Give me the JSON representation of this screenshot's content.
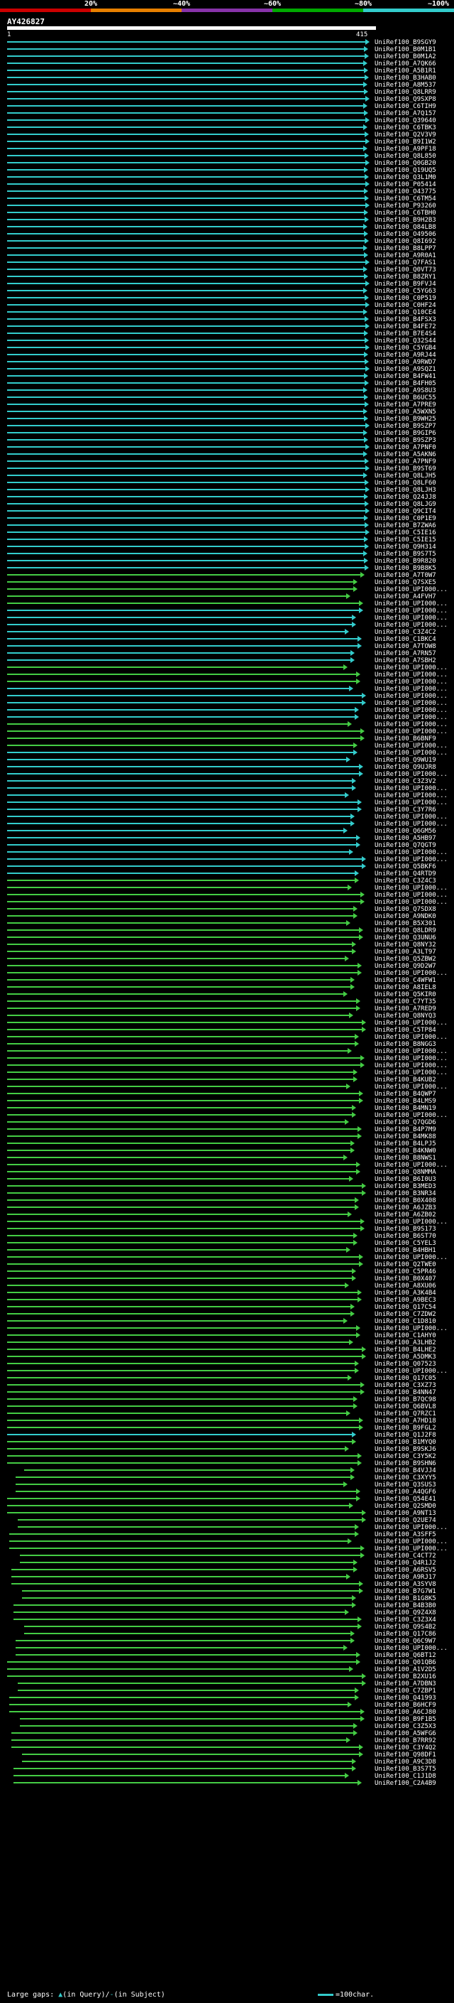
{
  "scale": {
    "labels": [
      "20%",
      "~40%",
      "~60%",
      "~80%",
      "~100%"
    ],
    "colors": [
      "#cc0000",
      "#e88000",
      "#8833aa",
      "#00aa00",
      "#33cccc"
    ]
  },
  "query": {
    "name": "AY426827",
    "start": "1",
    "end": "415"
  },
  "colors": {
    "cyan": "#33cccc",
    "green": "#44cc44",
    "gap": "#222222"
  },
  "hits": [
    "UniRef100_B9SGY9",
    "UniRef100_B0M1B1",
    "UniRef100_B0M1A2",
    "UniRef100_A7QK66",
    "UniRef100_A5B1R1",
    "UniRef100_B3HAB0",
    "UniRef100_A8M537",
    "UniRef100_Q8LRR9",
    "UniRef100_Q9SXP8",
    "UniRef100_C6TIH9",
    "UniRef100_A7Q157",
    "UniRef100_Q39640",
    "UniRef100_C6TBK3",
    "UniRef100_Q2V3V9",
    "UniRef100_B9I1W2",
    "UniRef100_A9PF18",
    "UniRef100_Q8L850",
    "UniRef100_Q0GB20",
    "UniRef100_Q19UQ5",
    "UniRef100_Q3L1M0",
    "UniRef100_P05414",
    "UniRef100_O43775",
    "UniRef100_C6TM54",
    "UniRef100_P93260",
    "UniRef100_C6TBH0",
    "UniRef100_B9H2B3",
    "UniRef100_Q84LB8",
    "UniRef100_O49506",
    "UniRef100_Q8I692",
    "UniRef100_B8LPP7",
    "UniRef100_A9R0A1",
    "UniRef100_Q7FAS1",
    "UniRef100_Q0VT73",
    "UniRef100_B8ZRY1",
    "UniRef100_B9FVJ4",
    "UniRef100_C5YG63",
    "UniRef100_C0P519",
    "UniRef100_C0HF24",
    "UniRef100_Q10CE4",
    "UniRef100_B4FSX3",
    "UniRef100_B4FE72",
    "UniRef100_B7E4S4",
    "UniRef100_Q32S44",
    "UniRef100_C5YGB4",
    "UniRef100_A9RJ44",
    "UniRef100_A9RWD7",
    "UniRef100_A9SQZ1",
    "UniRef100_B4FW41",
    "UniRef100_B4FH05",
    "UniRef100_A9S8U3",
    "UniRef100_B6UC55",
    "UniRef100_A7PRE9",
    "UniRef100_A5WXN5",
    "UniRef100_B9WH25",
    "UniRef100_B9SZP7",
    "UniRef100_B9GIP6",
    "UniRef100_B9SZP3",
    "UniRef100_A7PNF0",
    "UniRef100_A5AKN6",
    "UniRef100_A7PNF9",
    "UniRef100_B9ST69",
    "UniRef100_Q8LJH5",
    "UniRef100_Q8LF60",
    "UniRef100_Q8LJH3",
    "UniRef100_Q24JJ8",
    "UniRef100_Q8LJG9",
    "UniRef100_Q9CIT4",
    "UniRef100_C0P1E9",
    "UniRef100_B7ZWA6",
    "UniRef100_C5IE16",
    "UniRef100_C5IE15",
    "UniRef100_Q9H314",
    "UniRef100_B9S7T5",
    "UniRef100_B9R820",
    "UniRef100_B9B8K5",
    "UniRef100_A7T0W7",
    "UniRef100_Q7SXE5",
    "UniRef100_UPI000...",
    "UniRef100_A4FVH7",
    "UniRef100_UPI000...",
    "UniRef100_UPI000...",
    "UniRef100_UPI000...",
    "UniRef100_UPI000...",
    "UniRef100_C3Z4C2",
    "UniRef100_C1BKC4",
    "UniRef100_A7TOW8",
    "UniRef100_A7RN57",
    "UniRef100_A7SBH2",
    "UniRef100_UPI000...",
    "UniRef100_UPI000...",
    "UniRef100_UPI000...",
    "UniRef100_UPI000...",
    "UniRef100_UPI000...",
    "UniRef100_UPI000...",
    "UniRef100_UPI000...",
    "UniRef100_UPI000...",
    "UniRef100_UPI000...",
    "UniRef100_UPI000...",
    "UniRef100_B6BNF9",
    "UniRef100_UPI000...",
    "UniRef100_UPI000...",
    "UniRef100_Q9WU19",
    "UniRef100_Q9UJR8",
    "UniRef100_UPI000...",
    "UniRef100_C3Z3V2",
    "UniRef100_UPI000...",
    "UniRef100_UPI000...",
    "UniRef100_UPI000...",
    "UniRef100_C3Y7R6",
    "UniRef100_UPI000...",
    "UniRef100_UPI000...",
    "UniRef100_Q6GM56",
    "UniRef100_A5HB97",
    "UniRef100_Q7QGT9",
    "UniRef100_UPI000...",
    "UniRef100_UPI000...",
    "UniRef100_Q5BKF6",
    "UniRef100_Q4RTD9",
    "UniRef100_C3Z4C3",
    "UniRef100_UPI000...",
    "UniRef100_UPI000...",
    "UniRef100_UPI000...",
    "UniRef100_Q7SDX8",
    "UniRef100_A9NDK0",
    "UniRef100_B5X301",
    "UniRef100_Q8LDR9",
    "UniRef100_Q3UNU6",
    "UniRef100_Q8NY32",
    "UniRef100_A3LT97",
    "UniRef100_Q5ZBW2",
    "UniRef100_Q9D2W7",
    "UniRef100_UPI000...",
    "UniRef100_C4WFW1",
    "UniRef100_A8IEL8",
    "UniRef100_Q5KIR0",
    "UniRef100_C7YT35",
    "UniRef100_A7RED9",
    "UniRef100_Q8NYQ3",
    "UniRef100_UPI000...",
    "UniRef100_C5TP84",
    "UniRef100_UPI000...",
    "UniRef100_B8NGG3",
    "UniRef100_UPI000...",
    "UniRef100_UPI000...",
    "UniRef100_UPI000...",
    "UniRef100_UPI000...",
    "UniRef100_B4KUB2",
    "UniRef100_UPI000...",
    "UniRef100_B4QWP7",
    "UniRef100_B4LMS9",
    "UniRef100_B4MN19",
    "UniRef100_UPI000...",
    "UniRef100_Q7QGD6",
    "UniRef100_B4P7M9",
    "UniRef100_B4MK88",
    "UniRef100_B4LPJ5",
    "UniRef100_B4KNW0",
    "UniRef100_B8NWS1",
    "UniRef100_UPI000...",
    "UniRef100_Q8NMMA",
    "UniRef100_B6I0U3",
    "UniRef100_B3MED3",
    "UniRef100_B3NR34",
    "UniRef100_B0X408",
    "UniRef100_A6JZB3",
    "UniRef100_A6ZB02",
    "UniRef100_UPI000...",
    "UniRef100_B9S173",
    "UniRef100_B6ST70",
    "UniRef100_C5YEL3",
    "UniRef100_B4HBH1",
    "UniRef100_UPI000...",
    "UniRef100_Q2TWE0",
    "UniRef100_C5PR46",
    "UniRef100_B0X407",
    "UniRef100_A8XU06",
    "UniRef100_A3K4B4",
    "UniRef100_A9BEC3",
    "UniRef100_Q17C54",
    "UniRef100_C7ZDW2",
    "UniRef100_C1D810",
    "UniRef100_UPI000...",
    "UniRef100_C1AHY0",
    "UniRef100_A3LHB2",
    "UniRef100_B4LHE2",
    "UniRef100_A5DMK3",
    "UniRef100_Q07523",
    "UniRef100_UPI000...",
    "UniRef100_Q17C05",
    "UniRef100_C3XZ73",
    "UniRef100_B4NN47",
    "UniRef100_B7QC98",
    "UniRef100_Q6BVL8",
    "UniRef100_Q7RZC1",
    "UniRef100_A7HD18",
    "UniRef100_B9FGL2",
    "UniRef100_Q1J2F8",
    "UniRef100_B1MYQ0",
    "UniRef100_B9SKJ6",
    "UniRef100_C3Y5K2",
    "UniRef100_B9SHN6",
    "UniRef100_B4VJJ4",
    "UniRef100_C3XYY5",
    "UniRef100_Q3SUS3",
    "UniRef100_A4QGF6",
    "UniRef100_Q54E41",
    "UniRef100_Q2SMD0",
    "UniRef100_A9NT13",
    "UniRef100_Q2UE74",
    "UniRef100_UPI000...",
    "UniRef100_A3SFF5",
    "UniRef100_UPI000...",
    "UniRef100_UPI000...",
    "UniRef100_C4CT72",
    "UniRef100_Q4R1J2",
    "UniRef100_A6RSV5",
    "UniRef100_A9RJ17",
    "UniRef100_A3SYV8",
    "UniRef100_B7G7W1",
    "UniRef100_B1G8K5",
    "UniRef100_B4B3B0",
    "UniRef100_Q9Z4X8",
    "UniRef100_C3Z3X4",
    "UniRef100_Q9S4B2",
    "UniRef100_Q17C86",
    "UniRef100_Q6C9W7",
    "UniRef100_UPI000...",
    "UniRef100_Q6BT12",
    "UniRef100_Q01QB6",
    "UniRef100_A1V2D5",
    "UniRef100_B2XU16",
    "UniRef100_A7DBN3",
    "UniRef100_C7ZBP1",
    "UniRef100_Q41993",
    "UniRef100_B6HCF9",
    "UniRef100_A6CJ80",
    "UniRef100_B9F1B5",
    "UniRef100_C3Z5X3",
    "UniRef100_A5WFG6",
    "UniRef100_B7RR92",
    "UniRef100_C3Y4Q2",
    "UniRef100_Q98DF1",
    "UniRef100_A9C3D8",
    "UniRef100_B3S7T5",
    "UniRef100_C1J1D8",
    "UniRef100_C2A4B9"
  ],
  "legend": {
    "left_prefix": "Large gaps:",
    "left_mid": "(in Query)/",
    "left_suffix": "(in Subject)",
    "right": "=100char."
  }
}
